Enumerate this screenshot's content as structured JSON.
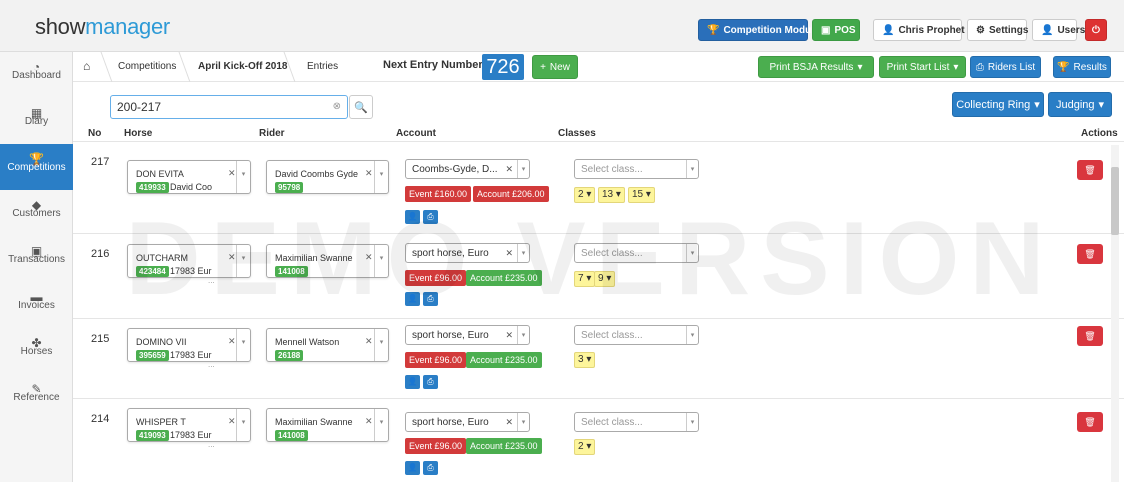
{
  "app": {
    "logo_show": "show",
    "logo_manager": "manager"
  },
  "topbar": {
    "competition_module": "Competition Module",
    "pos": "POS",
    "user": "Chris Prophet",
    "settings": "Settings",
    "users": "Users"
  },
  "sidebar": {
    "items": [
      {
        "label": "Dashboard",
        "icon": "dashboard-icon"
      },
      {
        "label": "Diary",
        "icon": "calendar-icon"
      },
      {
        "label": "Competitions",
        "icon": "trophy-icon",
        "active": true
      },
      {
        "label": "Customers",
        "icon": "tag-icon"
      },
      {
        "label": "Transactions",
        "icon": "money-icon"
      },
      {
        "label": "Invoices",
        "icon": "briefcase-icon"
      },
      {
        "label": "Horses",
        "icon": "paw-icon"
      },
      {
        "label": "Reference",
        "icon": "wrench-icon"
      }
    ]
  },
  "breadcrumb": {
    "competitions": "Competitions",
    "event": "April Kick-Off 2018",
    "entries": "Entries"
  },
  "next_entry": {
    "label": "Next Entry Number:",
    "number": "726",
    "new_button": "New"
  },
  "actions": {
    "print_bsja": "Print BSJA Results",
    "print_start": "Print Start List",
    "riders_list": "Riders List",
    "results": "Results",
    "collecting_ring": "Collecting Ring",
    "judging": "Judging"
  },
  "search": {
    "value": "200-217"
  },
  "table": {
    "headers": {
      "no": "No",
      "horse": "Horse",
      "rider": "Rider",
      "account": "Account",
      "classes": "Classes",
      "actions": "Actions"
    },
    "rows": [
      {
        "no": "217",
        "horse": "DON EVITA",
        "horse_id": "419933",
        "horse_owner": "David Coo",
        "rider": "David Coombs Gyde",
        "rider_id": "95798",
        "account": "Coombs-Gyde, D...",
        "event": "Event £160.00",
        "account_bal": "Account £206.00",
        "account_status": "red",
        "class_placeholder": "Select class...",
        "classes": [
          "2",
          "13",
          "15"
        ]
      },
      {
        "no": "216",
        "horse": "OUTCHARM",
        "horse_id": "423484",
        "horse_owner": "17983 Eur",
        "rider": "Maximilian Swanne",
        "rider_id": "141008",
        "account": "sport horse, Euro",
        "event": "Event £96.00",
        "account_bal": "Account £235.00",
        "account_status": "green",
        "class_placeholder": "Select class...",
        "classes": [
          "7",
          "9"
        ]
      },
      {
        "no": "215",
        "horse": "DOMINO VII",
        "horse_id": "395659",
        "horse_owner": "17983 Eur",
        "rider": "Mennell Watson",
        "rider_id": "26188",
        "account": "sport horse, Euro",
        "event": "Event £96.00",
        "account_bal": "Account £235.00",
        "account_status": "green",
        "class_placeholder": "Select class...",
        "classes": [
          "3"
        ]
      },
      {
        "no": "214",
        "horse": "WHISPER T",
        "horse_id": "419093",
        "horse_owner": "17983 Eur",
        "rider": "Maximilian Swanne",
        "rider_id": "141008",
        "account": "sport horse, Euro",
        "event": "Event £96.00",
        "account_bal": "Account £235.00",
        "account_status": "green",
        "class_placeholder": "Select class...",
        "classes": [
          "2"
        ]
      }
    ]
  },
  "watermark": "DEMO VERSION",
  "colors": {
    "primary": "#2a7ec6",
    "success": "#4bae4f",
    "danger": "#d9363e",
    "class_tag": "#fdf59b"
  }
}
